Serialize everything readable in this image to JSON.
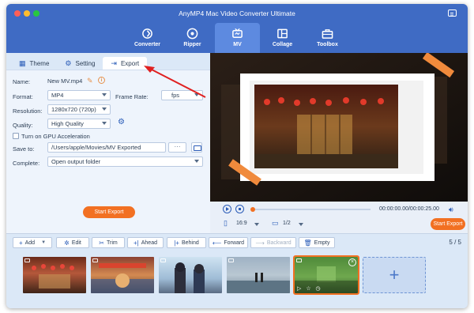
{
  "window": {
    "title": "AnyMP4 Mac Video Converter Ultimate"
  },
  "nav": {
    "items": [
      {
        "label": "Converter",
        "icon": "converter-icon"
      },
      {
        "label": "Ripper",
        "icon": "ripper-icon"
      },
      {
        "label": "MV",
        "icon": "mv-icon",
        "active": true
      },
      {
        "label": "Collage",
        "icon": "collage-icon"
      },
      {
        "label": "Toolbox",
        "icon": "toolbox-icon"
      }
    ]
  },
  "tabs": {
    "theme": "Theme",
    "setting": "Setting",
    "export": "Export",
    "active": "Export"
  },
  "export": {
    "name_label": "Name:",
    "name_value": "New MV.mp4",
    "format_label": "Format:",
    "format_value": "MP4",
    "frame_rate_label": "Frame Rate:",
    "frame_rate_value": "fps",
    "resolution_label": "Resolution:",
    "resolution_value": "1280x720 (720p)",
    "quality_label": "Quality:",
    "quality_value": "High Quality",
    "gpu_label": "Turn on GPU Acceleration",
    "gpu_checked": false,
    "save_label": "Save to:",
    "save_value": "/Users/apple/Movies/MV Exported",
    "more_label": "···",
    "complete_label": "Complete:",
    "complete_value": "Open output folder",
    "start_export": "Start Export"
  },
  "player": {
    "time": "00:00:00.00/00:00:25.00",
    "aspect": "16:9",
    "page": "1/2",
    "start_export": "Start Export",
    "progress": 0
  },
  "toolbar": {
    "add": "Add",
    "edit": "Edit",
    "trim": "Trim",
    "ahead": "Ahead",
    "behind": "Behind",
    "forward": "Forward",
    "backward": "Backward",
    "empty": "Empty",
    "counter": "5 / 5"
  },
  "timeline": {
    "clips": 5,
    "selected": 5
  },
  "colors": {
    "accent": "#f27022",
    "brand": "#3f6bc4",
    "panel": "#dbe8f7"
  }
}
